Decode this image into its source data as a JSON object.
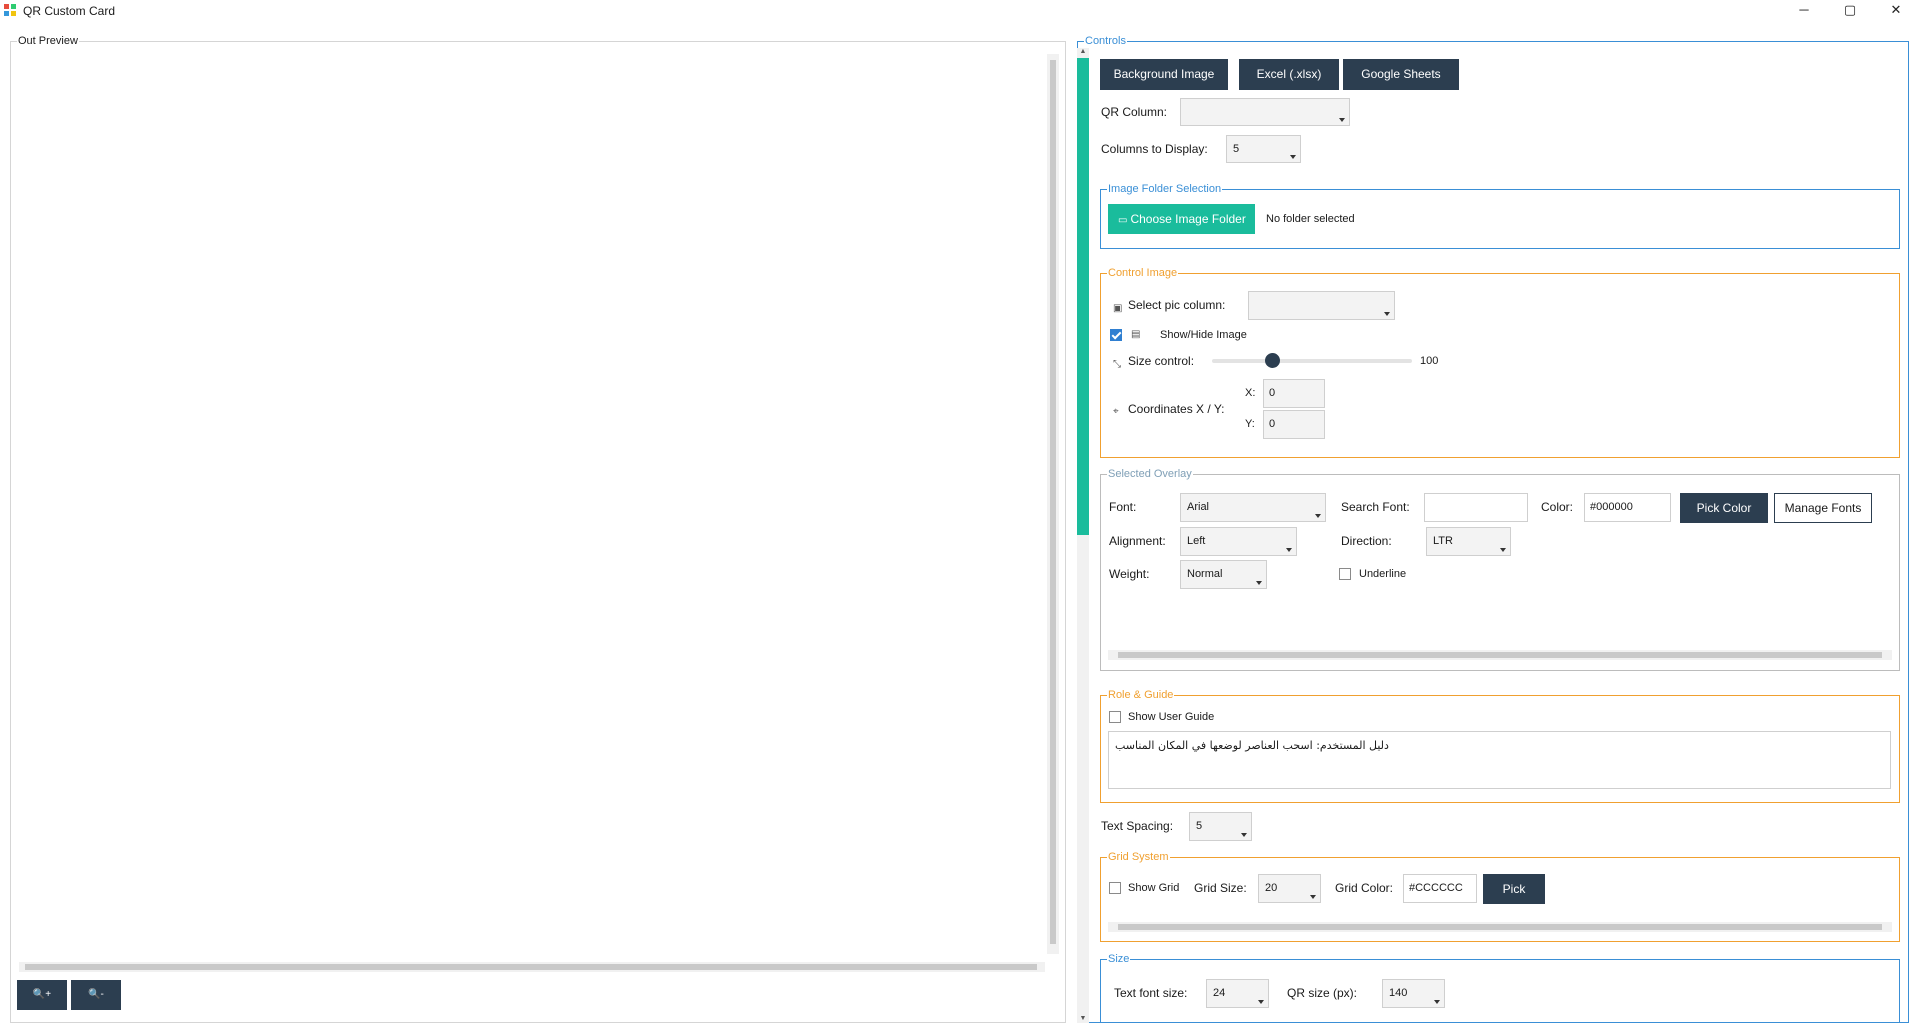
{
  "window": {
    "title": "QR Custom Card",
    "controls": {
      "minimize": "─",
      "maximize": "▢",
      "close": "✕"
    }
  },
  "preview": {
    "legend": "Out Preview",
    "zoom_in": "🔍+",
    "zoom_out": "🔍-"
  },
  "controls": {
    "legend": "Controls",
    "buttons": {
      "background_image": "Background Image",
      "excel": "Excel (.xlsx)",
      "google_sheets": "Google Sheets"
    },
    "qr_column_label": "QR Column:",
    "qr_column_value": "",
    "columns_display_label": "Columns to Display:",
    "columns_display_value": "5"
  },
  "image_folder": {
    "legend": "Image Folder Selection",
    "button": "Choose Image Folder",
    "status": "No folder selected"
  },
  "control_image": {
    "legend": "Control Image",
    "select_pic_label": "Select pic column:",
    "select_pic_value": "",
    "show_hide_label": "Show/Hide Image",
    "show_hide_checked": true,
    "size_label": "Size control:",
    "size_value": "100",
    "size_fraction": 0.3,
    "coords_label": "Coordinates X / Y:",
    "x_label": "X:",
    "x_value": "0",
    "y_label": "Y:",
    "y_value": "0"
  },
  "selected_overlay": {
    "legend": "Selected Overlay",
    "font_label": "Font:",
    "font_value": "Arial",
    "search_font_label": "Search Font:",
    "search_font_value": "",
    "color_label": "Color:",
    "color_value": "#000000",
    "pick_color": "Pick Color",
    "manage_fonts": "Manage Fonts",
    "alignment_label": "Alignment:",
    "alignment_value": "Left",
    "direction_label": "Direction:",
    "direction_value": "LTR",
    "weight_label": "Weight:",
    "weight_value": "Normal",
    "underline_label": "Underline",
    "underline_checked": false
  },
  "role_guide": {
    "legend": "Role & Guide",
    "show_guide_label": "Show User Guide",
    "show_guide_checked": false,
    "guide_text": "دليل المستخدم: اسحب العناصر لوضعها في المكان المناسب"
  },
  "text_spacing": {
    "label": "Text Spacing:",
    "value": "5"
  },
  "grid_system": {
    "legend": "Grid System",
    "show_grid_label": "Show Grid",
    "show_grid_checked": false,
    "grid_size_label": "Grid Size:",
    "grid_size_value": "20",
    "grid_color_label": "Grid Color:",
    "grid_color_value": "#CCCCCC",
    "pick": "Pick"
  },
  "size": {
    "legend": "Size",
    "text_font_label": "Text font size:",
    "text_font_value": "24",
    "qr_size_label": "QR size (px):",
    "qr_size_value": "140"
  },
  "colors": {
    "dark_button": "#2c3e50",
    "teal": "#1abc9c",
    "blue_group": "#3a8fd6",
    "orange_group": "#f0a030",
    "gray_group": "#bcbcbc"
  }
}
